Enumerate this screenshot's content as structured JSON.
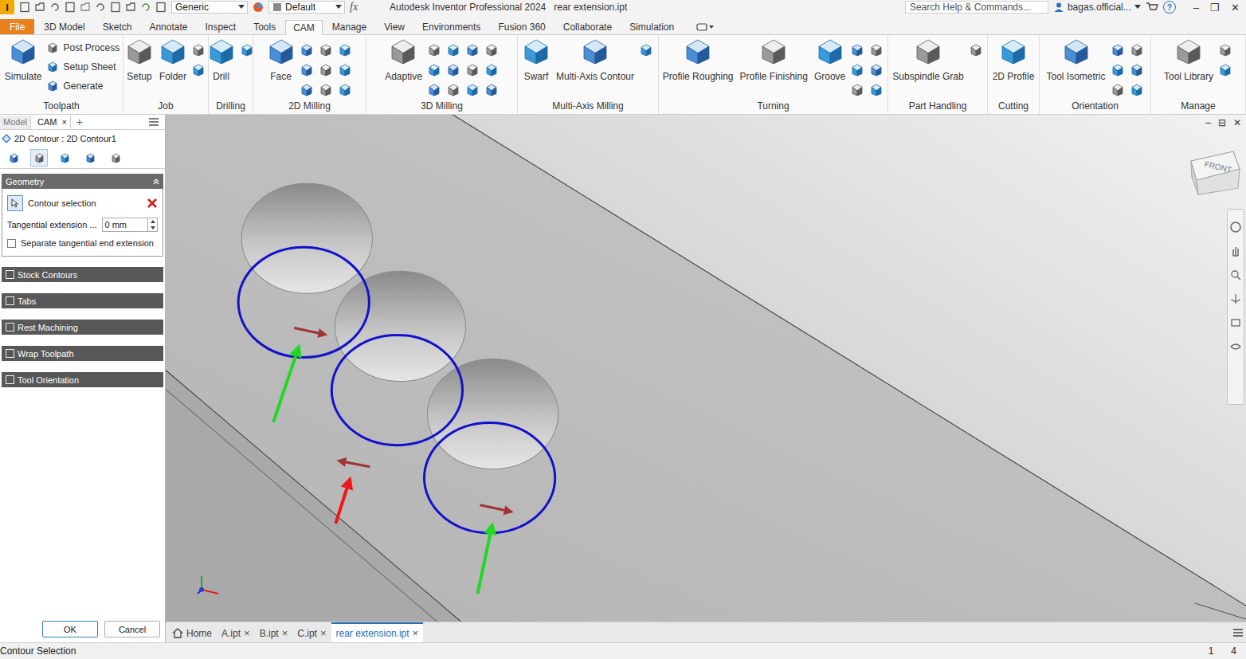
{
  "title_bar": {
    "app_icon": "I",
    "style_dropdown": "Generic",
    "appearance_dropdown": "Default",
    "fx": "fx",
    "title": "Autodesk Inventor Professional 2024",
    "document": "rear extension.ipt",
    "search_placeholder": "Search Help & Commands...",
    "user": "bagas.official...",
    "help": "?",
    "window_controls": [
      "–",
      "❐",
      "✕"
    ]
  },
  "ribbon_tabs": [
    {
      "label": "File",
      "kind": "file",
      "selected": false
    },
    {
      "label": "3D Model",
      "kind": "tab",
      "selected": false
    },
    {
      "label": "Sketch",
      "kind": "tab",
      "selected": false
    },
    {
      "label": "Annotate",
      "kind": "tab",
      "selected": false
    },
    {
      "label": "Inspect",
      "kind": "tab",
      "selected": false
    },
    {
      "label": "Tools",
      "kind": "tab",
      "selected": false
    },
    {
      "label": "CAM",
      "kind": "tab",
      "selected": true
    },
    {
      "label": "Manage",
      "kind": "tab",
      "selected": false
    },
    {
      "label": "View",
      "kind": "tab",
      "selected": false
    },
    {
      "label": "Environments",
      "kind": "tab",
      "selected": false
    },
    {
      "label": "Fusion 360",
      "kind": "tab",
      "selected": false
    },
    {
      "label": "Collaborate",
      "kind": "tab",
      "selected": false
    },
    {
      "label": "Simulation",
      "kind": "tab",
      "selected": false
    }
  ],
  "ribbon_groups": [
    {
      "label": "Toolpath",
      "buttons": [
        {
          "label": "Simulate",
          "kind": "large"
        },
        {
          "label": "Post Process",
          "kind": "small"
        },
        {
          "label": "Setup Sheet",
          "kind": "small"
        },
        {
          "label": "Generate",
          "kind": "small"
        }
      ]
    },
    {
      "label": "Job",
      "buttons": [
        {
          "label": "Setup",
          "kind": "large"
        },
        {
          "label": "Folder",
          "kind": "large"
        }
      ]
    },
    {
      "label": "Drilling",
      "buttons": [
        {
          "label": "Drill",
          "kind": "large"
        }
      ]
    },
    {
      "label": "2D Milling",
      "buttons": [
        {
          "label": "Face",
          "kind": "large"
        }
      ]
    },
    {
      "label": "3D Milling",
      "buttons": [
        {
          "label": "Adaptive",
          "kind": "large"
        }
      ]
    },
    {
      "label": "Multi-Axis Milling",
      "buttons": [
        {
          "label": "Swarf",
          "kind": "large"
        },
        {
          "label": "Multi-Axis Contour",
          "kind": "large"
        }
      ]
    },
    {
      "label": "Turning",
      "buttons": [
        {
          "label": "Profile Roughing",
          "kind": "large"
        },
        {
          "label": "Profile Finishing",
          "kind": "large"
        },
        {
          "label": "Groove",
          "kind": "large"
        }
      ]
    },
    {
      "label": "Part Handling",
      "buttons": [
        {
          "label": "Subspindle Grab",
          "kind": "large"
        }
      ]
    },
    {
      "label": "Cutting",
      "buttons": [
        {
          "label": "2D Profile",
          "kind": "large"
        }
      ]
    },
    {
      "label": "Orientation",
      "buttons": [
        {
          "label": "Tool Isometric",
          "kind": "large"
        }
      ]
    },
    {
      "label": "Manage",
      "buttons": [
        {
          "label": "Tool Library",
          "kind": "large"
        }
      ]
    }
  ],
  "browser_tabs": [
    {
      "label": "Model",
      "selected": false,
      "closable": false
    },
    {
      "label": "CAM",
      "selected": true,
      "closable": true
    }
  ],
  "browser_add": "+",
  "close": "×",
  "operation": {
    "title": "2D Contour : 2D Contour1",
    "tabs": [
      {
        "selected": false
      },
      {
        "selected": true
      },
      {
        "selected": false
      },
      {
        "selected": false
      },
      {
        "selected": false
      }
    ]
  },
  "geometry": {
    "title": "Geometry",
    "contour_selection": "Contour selection",
    "tangential_extension": {
      "label": "Tangential extension ...",
      "value": "0 mm"
    },
    "separate_end_extension": {
      "label": "Separate tangential end extension",
      "checked": false
    }
  },
  "sections": [
    {
      "label": "Stock Contours",
      "checked": false
    },
    {
      "label": "Tabs",
      "checked": false
    },
    {
      "label": "Rest Machining",
      "checked": false
    },
    {
      "label": "Wrap Toolpath",
      "checked": false
    },
    {
      "label": "Tool Orientation",
      "checked": false
    }
  ],
  "dialog_buttons": [
    {
      "label": "OK",
      "default": true
    },
    {
      "label": "Cancel",
      "default": false
    }
  ],
  "viewport": {
    "controls": [
      "–",
      "⊟",
      "✕"
    ],
    "viewcube": "FRONT"
  },
  "document_tabs": [
    {
      "label": "Home",
      "kind": "home",
      "selected": false,
      "closable": false
    },
    {
      "label": "A.ipt",
      "kind": "doc",
      "selected": false,
      "closable": true
    },
    {
      "label": "B.ipt",
      "kind": "doc",
      "selected": false,
      "closable": true
    },
    {
      "label": "C.ipt",
      "kind": "doc",
      "selected": false,
      "closable": true
    },
    {
      "label": "rear extension.ipt",
      "kind": "doc",
      "selected": true,
      "closable": true
    }
  ],
  "status_bar": {
    "message": "Contour Selection",
    "values": [
      "1",
      "4"
    ]
  }
}
